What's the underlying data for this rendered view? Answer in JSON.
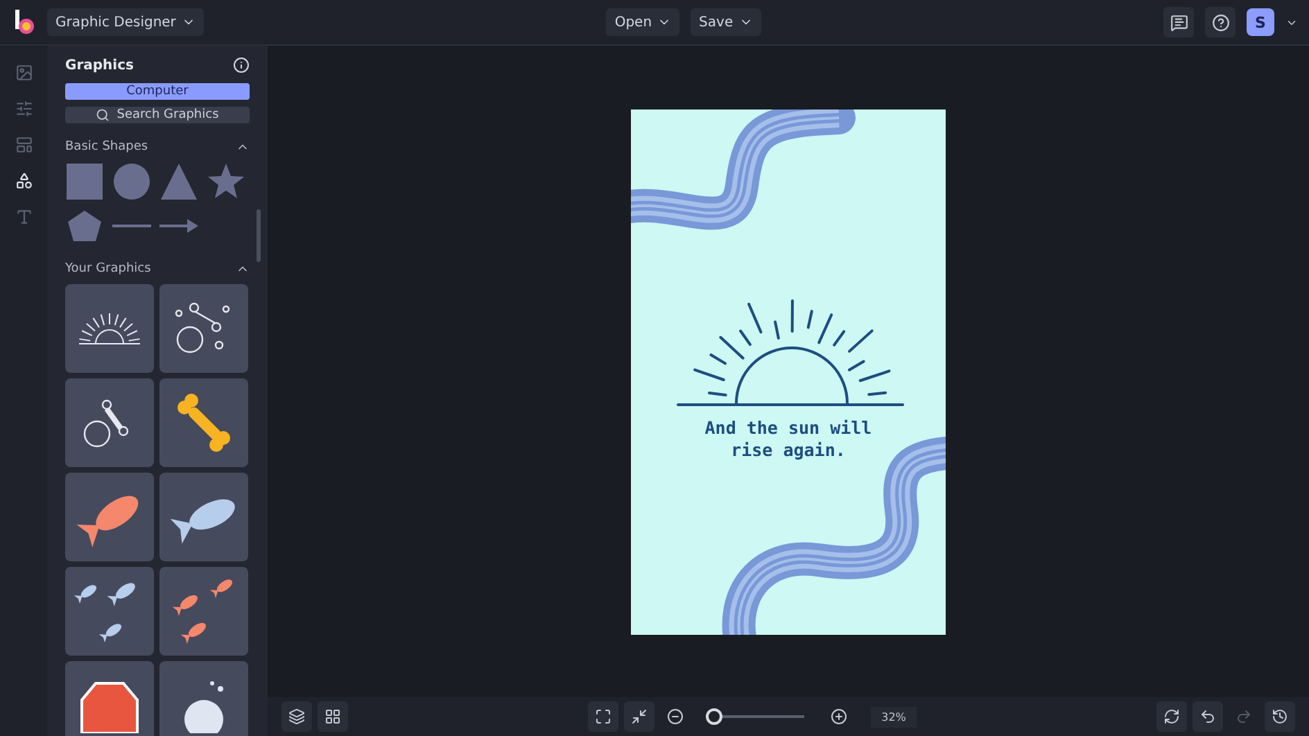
{
  "topbar": {
    "project_menu": "Graphic Designer",
    "open_menu": "Open",
    "save_menu": "Save",
    "avatar": "S"
  },
  "rail": [
    {
      "kind": "photo",
      "selected": false
    },
    {
      "kind": "adjust",
      "selected": false
    },
    {
      "kind": "layout",
      "selected": false
    },
    {
      "kind": "graphics",
      "selected": true
    },
    {
      "kind": "text",
      "selected": false
    }
  ],
  "panel": {
    "title": "Graphics",
    "computer_button": "Computer",
    "search_button": "Search Graphics",
    "sections": [
      {
        "title": "Basic Shapes",
        "expanded": true
      },
      {
        "title": "Your Graphics",
        "expanded": true
      }
    ]
  },
  "artboard": {
    "quote": "And the sun will rise again."
  },
  "bottombar": {
    "zoom": {
      "level": 0.05,
      "reading": "32%"
    },
    "redo_disabled": true
  }
}
